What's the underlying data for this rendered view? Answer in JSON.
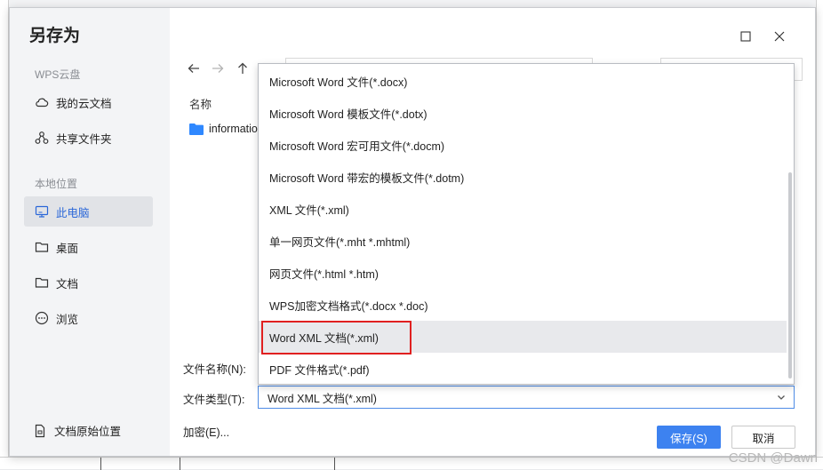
{
  "dialog": {
    "title": "另存为"
  },
  "sidebar": {
    "cloud_section": "WPS云盘",
    "cloud_items": [
      {
        "label": "我的云文档",
        "icon": "cloud-icon"
      },
      {
        "label": "共享文件夹",
        "icon": "share-icon"
      }
    ],
    "local_section": "本地位置",
    "local_items": [
      {
        "label": "此电脑",
        "icon": "monitor-icon",
        "active": true
      },
      {
        "label": "桌面",
        "icon": "folder-icon"
      },
      {
        "label": "文档",
        "icon": "folder-icon"
      },
      {
        "label": "浏览",
        "icon": "more-icon"
      }
    ],
    "original_location": "文档原始位置"
  },
  "file_list": {
    "column_name": "名称",
    "files": [
      {
        "name": "informatio",
        "icon": "folder-icon"
      }
    ]
  },
  "fields": {
    "filename_label": "文件名称(N):",
    "filetype_label": "文件类型(T):",
    "filetype_value": "Word XML 文档(*.xml)"
  },
  "dropdown": {
    "options": [
      "Microsoft Word 文件(*.docx)",
      "Microsoft Word 模板文件(*.dotx)",
      "Microsoft Word 宏可用文件(*.docm)",
      "Microsoft Word 带宏的模板文件(*.dotm)",
      "XML 文件(*.xml)",
      "单一网页文件(*.mht *.mhtml)",
      "网页文件(*.html *.htm)",
      "WPS加密文档格式(*.docx *.doc)",
      "Word XML 文档(*.xml)",
      "PDF 文件格式(*.pdf)"
    ],
    "selected_index": 8
  },
  "footer": {
    "encrypt_label": "加密(E)...",
    "save_label": "保存(S)",
    "cancel_label": "取消"
  },
  "watermark": "CSDN @Dawn",
  "colors": {
    "accent": "#3d82f0",
    "highlight_border": "#e02020",
    "folder": "#2f88ff"
  }
}
